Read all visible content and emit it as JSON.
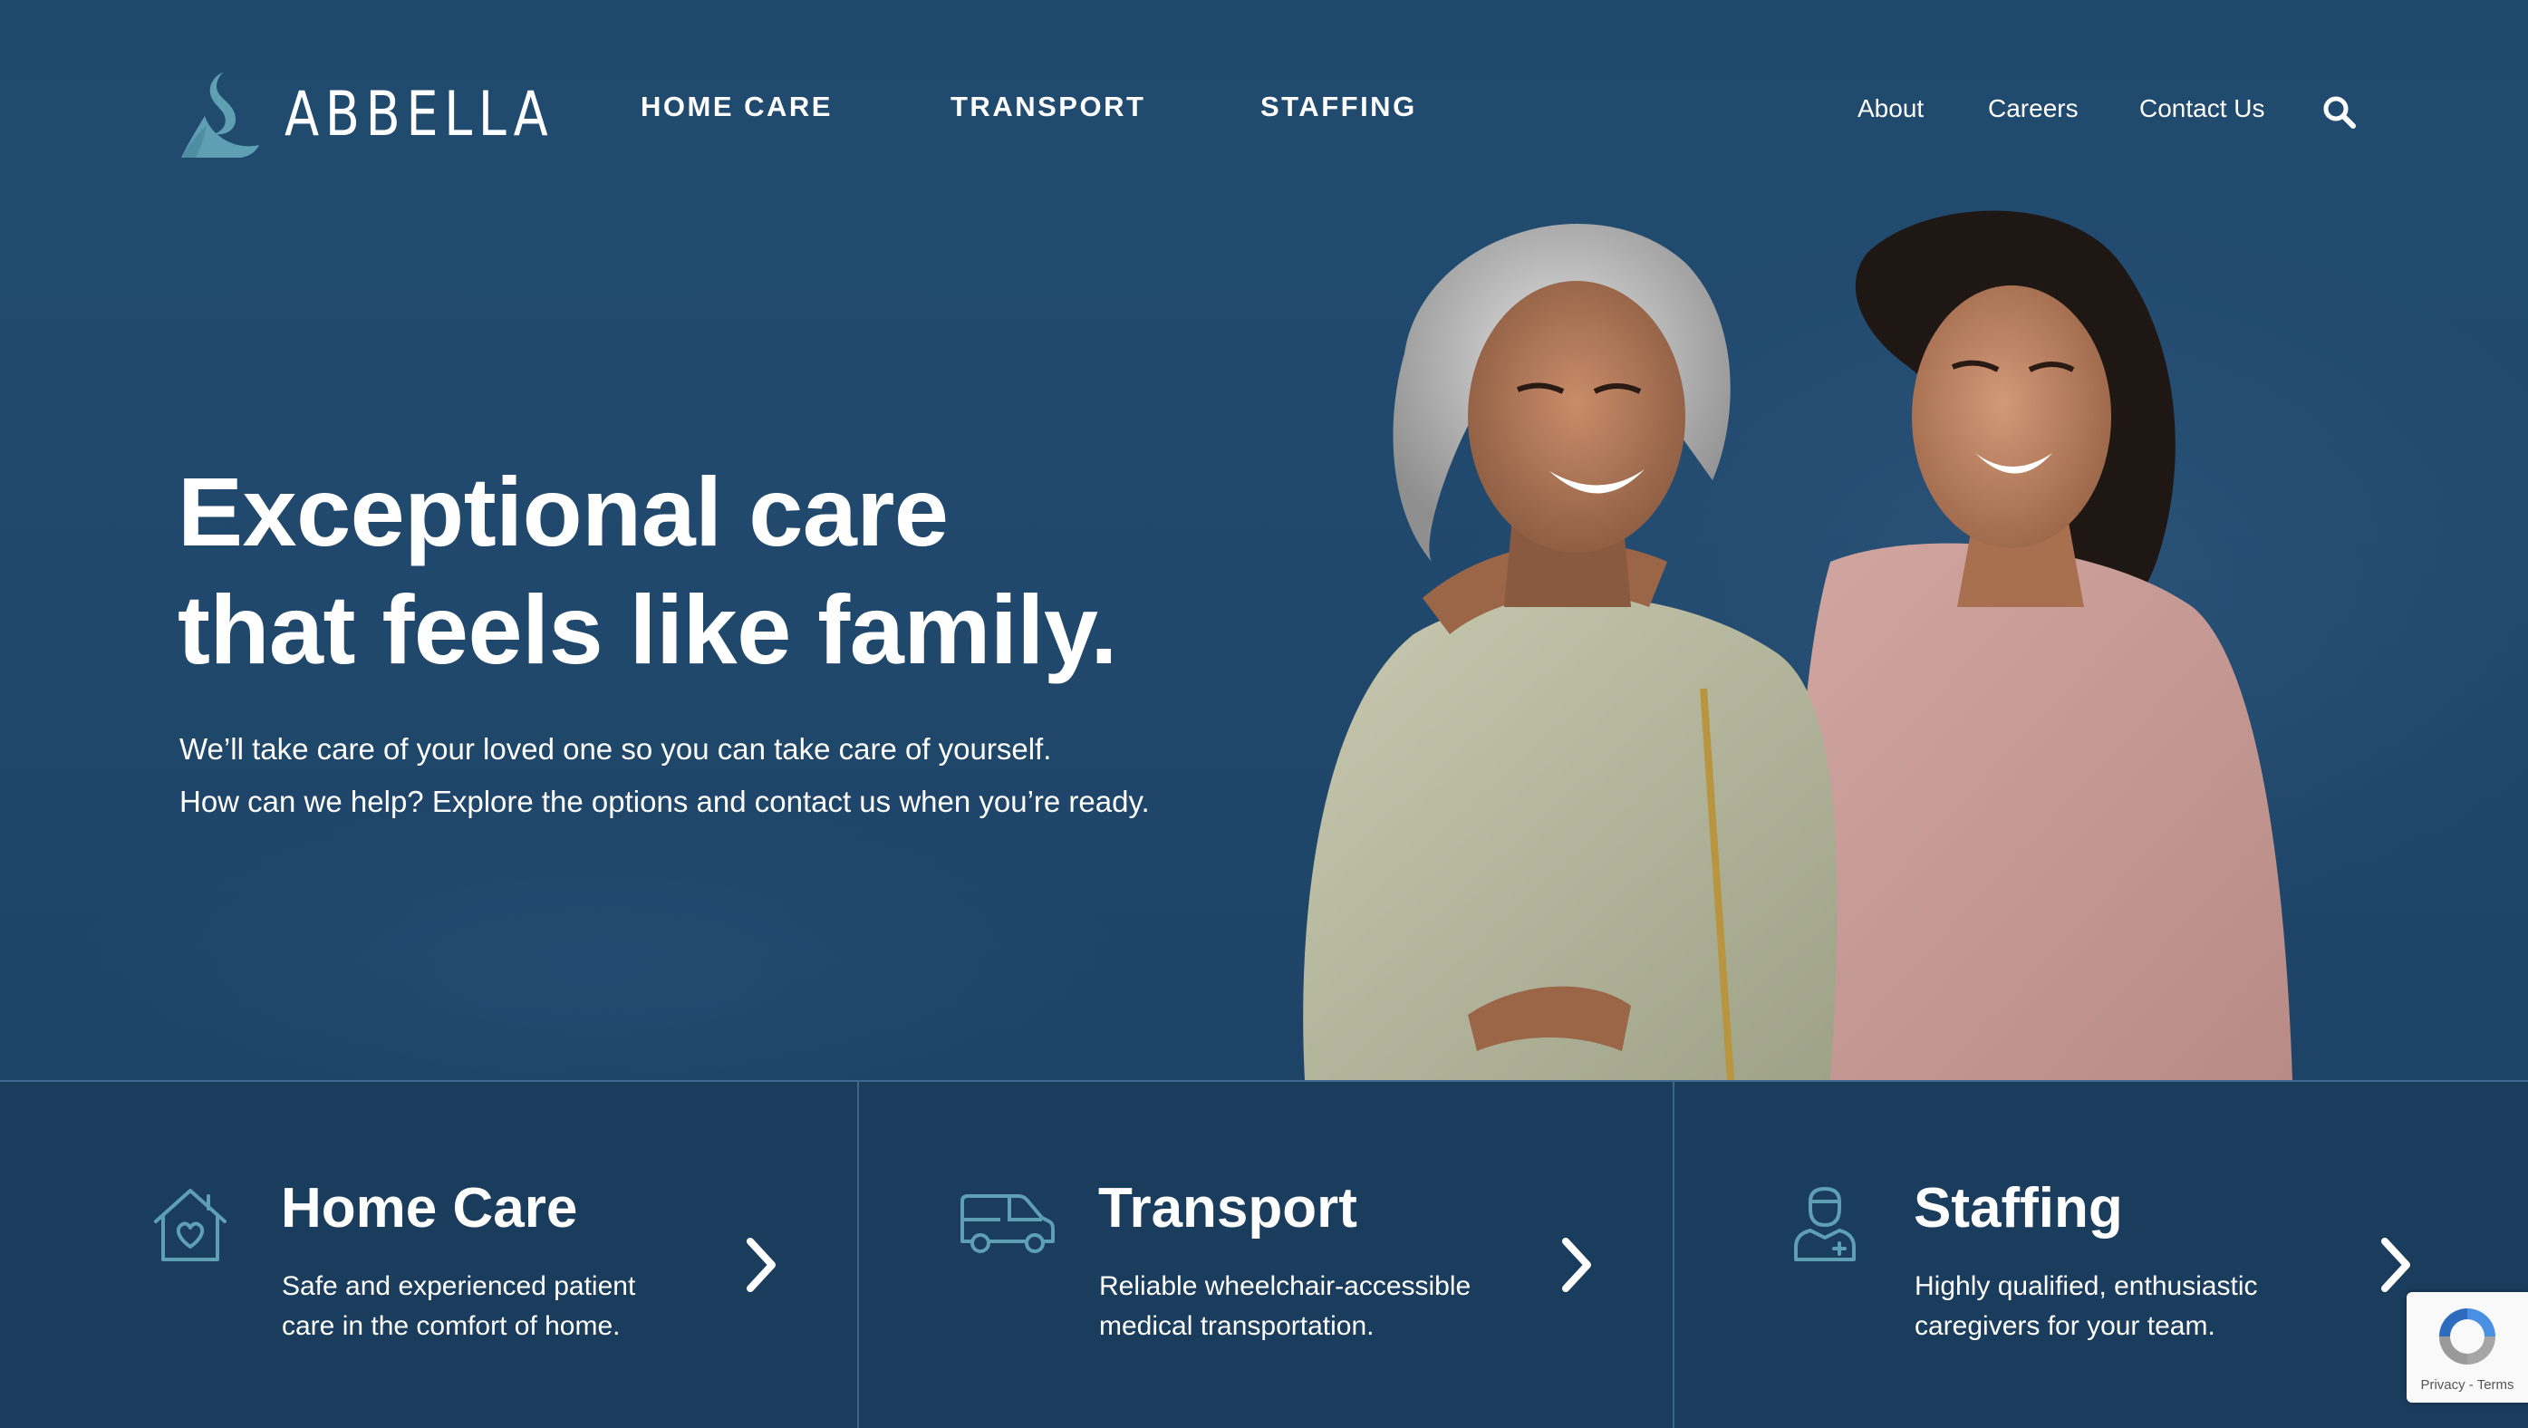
{
  "brand": {
    "name": "ABBELLA",
    "logo_icon": "person-swoosh-logo",
    "accent_color": "#5f9fb3"
  },
  "main_nav": [
    {
      "label": "HOME CARE"
    },
    {
      "label": "TRANSPORT"
    },
    {
      "label": "STAFFING"
    }
  ],
  "utility_nav": [
    {
      "label": "About"
    },
    {
      "label": "Careers"
    },
    {
      "label": "Contact Us"
    }
  ],
  "search": {
    "icon": "search-icon"
  },
  "hero": {
    "headline_line1": "Exceptional care",
    "headline_line2": "that feels like family.",
    "subtext_line1": "We’ll take care of your loved one so you can take care of yourself.",
    "subtext_line2": "How can we help? Explore the options and contact us when you’re ready.",
    "background_color": "#1f4a6e"
  },
  "services": [
    {
      "title": "Home Care",
      "desc_line1": "Safe and experienced patient",
      "desc_line2": "care in the comfort of home.",
      "icon": "house-heart-icon"
    },
    {
      "title": "Transport",
      "desc_line1": "Reliable wheelchair-accessible",
      "desc_line2": "medical transportation.",
      "icon": "van-icon"
    },
    {
      "title": "Staffing",
      "desc_line1": "Highly qualified, enthusiastic",
      "desc_line2": "caregivers for your team.",
      "icon": "nurse-icon"
    }
  ],
  "recaptcha": {
    "privacy": "Privacy",
    "separator": " - ",
    "terms": "Terms"
  }
}
